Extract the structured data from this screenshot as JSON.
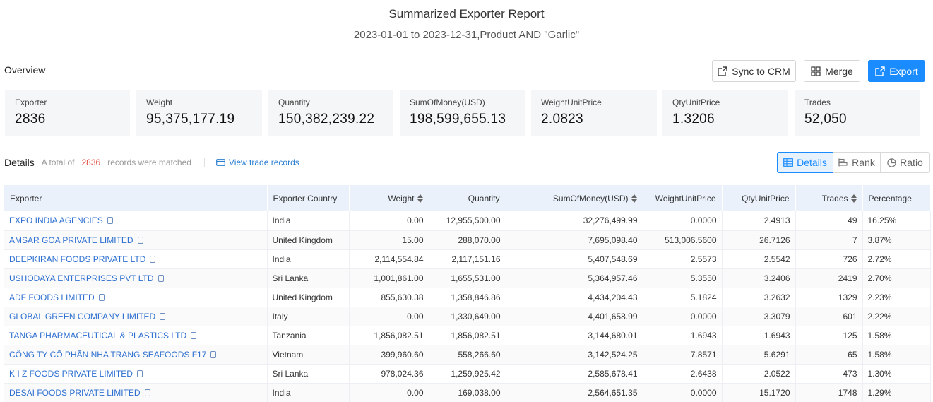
{
  "report": {
    "title": "Summarized Exporter Report",
    "subtitle": "2023-01-01 to 2023-12-31,Product AND \"Garlic\""
  },
  "overview": {
    "label": "Overview",
    "stats": [
      {
        "label": "Exporter",
        "value": "2836"
      },
      {
        "label": "Weight",
        "value": "95,375,177.19"
      },
      {
        "label": "Quantity",
        "value": "150,382,239.22"
      },
      {
        "label": "SumOfMoney(USD)",
        "value": "198,599,655.13"
      },
      {
        "label": "WeightUnitPrice",
        "value": "2.0823"
      },
      {
        "label": "QtyUnitPrice",
        "value": "1.3206"
      },
      {
        "label": "Trades",
        "value": "52,050"
      }
    ]
  },
  "toolbar": {
    "sync_label": "Sync to CRM",
    "merge_label": "Merge",
    "export_label": "Export"
  },
  "details": {
    "title": "Details",
    "note_prefix": "A total of",
    "count": "2836",
    "note_suffix": "records were matched",
    "view_trade_label": "View trade records"
  },
  "view_switch": {
    "details": "Details",
    "rank": "Rank",
    "ratio": "Ratio",
    "active": "details"
  },
  "colors": {
    "accent": "#1a8cff",
    "link": "#2d6fd0",
    "count": "#e04a3c",
    "header_bg": "#eaf1fb"
  },
  "table": {
    "columns": [
      "Exporter",
      "Exporter Country",
      "Weight",
      "Quantity",
      "SumOfMoney(USD)",
      "WeightUnitPrice",
      "QtyUnitPrice",
      "Trades",
      "Percentage"
    ],
    "rows": [
      [
        "EXPO INDIA AGENCIES",
        "India",
        "0.00",
        "12,955,500.00",
        "32,276,499.99",
        "0.0000",
        "2.4913",
        "49",
        "16.25%"
      ],
      [
        "AMSAR GOA PRIVATE LIMITED",
        "United Kingdom",
        "15.00",
        "288,070.00",
        "7,695,098.40",
        "513,006.5600",
        "26.7126",
        "7",
        "3.87%"
      ],
      [
        "DEEPKIRAN FOODS PRIVATE LTD",
        "India",
        "2,114,554.84",
        "2,117,151.16",
        "5,407,548.69",
        "2.5573",
        "2.5542",
        "726",
        "2.72%"
      ],
      [
        "USHODAYA ENTERPRISES PVT LTD",
        "Sri Lanka",
        "1,001,861.00",
        "1,655,531.00",
        "5,364,957.46",
        "5.3550",
        "3.2406",
        "2419",
        "2.70%"
      ],
      [
        "ADF FOODS LIMITED",
        "United Kingdom",
        "855,630.38",
        "1,358,846.86",
        "4,434,204.43",
        "5.1824",
        "3.2632",
        "1329",
        "2.23%"
      ],
      [
        "GLOBAL GREEN COMPANY LIMITED",
        "Italy",
        "0.00",
        "1,330,649.00",
        "4,401,658.99",
        "0.0000",
        "3.3079",
        "601",
        "2.22%"
      ],
      [
        "TANGA PHARMACEUTICAL & PLASTICS LTD",
        "Tanzania",
        "1,856,082.51",
        "1,856,082.51",
        "3,144,680.01",
        "1.6943",
        "1.6943",
        "125",
        "1.58%"
      ],
      [
        "CÔNG TY CỔ PHẦN NHA TRANG SEAFOODS F17",
        "Vietnam",
        "399,960.60",
        "558,266.60",
        "3,142,524.25",
        "7.8571",
        "5.6291",
        "65",
        "1.58%"
      ],
      [
        "K I Z FOODS PRIVATE LIMITED",
        "Sri Lanka",
        "978,024.36",
        "1,259,925.42",
        "2,585,678.41",
        "2.6438",
        "2.0522",
        "473",
        "1.30%"
      ],
      [
        "DESAI FOODS PRIVATE LIMITED",
        "India",
        "0.00",
        "169,038.00",
        "2,564,651.35",
        "0.0000",
        "15.1720",
        "1748",
        "1.29%"
      ]
    ]
  }
}
